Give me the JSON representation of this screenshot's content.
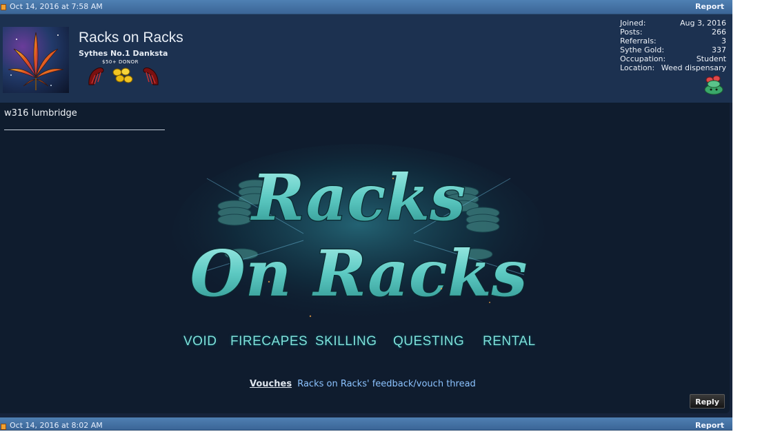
{
  "posts": [
    {
      "date": "Oct 14, 2016 at 7:58 AM",
      "report_label": "Report"
    },
    {
      "date": "Oct 14, 2016 at 8:02 AM",
      "report_label": "Report"
    }
  ],
  "user": {
    "name": "Racks on Racks",
    "title": "Sythes No.1 Danksta",
    "donor_badge_text": "$50+ DONOR"
  },
  "stats": [
    {
      "label": "Joined:",
      "value": "Aug 3, 2016"
    },
    {
      "label": "Posts:",
      "value": "266"
    },
    {
      "label": "Referrals:",
      "value": "3"
    },
    {
      "label": "Sythe Gold:",
      "value": "337"
    },
    {
      "label": "Occupation:",
      "value": "Student"
    },
    {
      "label": "Location:",
      "value": "Weed dispensary"
    }
  ],
  "message": "w316 lumbridge",
  "signature": {
    "banner_line1": "Racks",
    "banner_line2": "On Racks",
    "services": [
      "VOID",
      "FIRECAPES",
      "SKILLING",
      "QUESTING",
      "RENTAL"
    ]
  },
  "vouch": {
    "label": "Vouches",
    "link_text": "Racks on Racks' feedback/vouch thread"
  },
  "reply_label": "Reply",
  "colors": {
    "header_bar": "#4677a9",
    "user_panel": "#1c3150",
    "post_body": "#0f1c2e",
    "link": "#8cc3ff",
    "banner_teal": "#6fd6cf"
  }
}
